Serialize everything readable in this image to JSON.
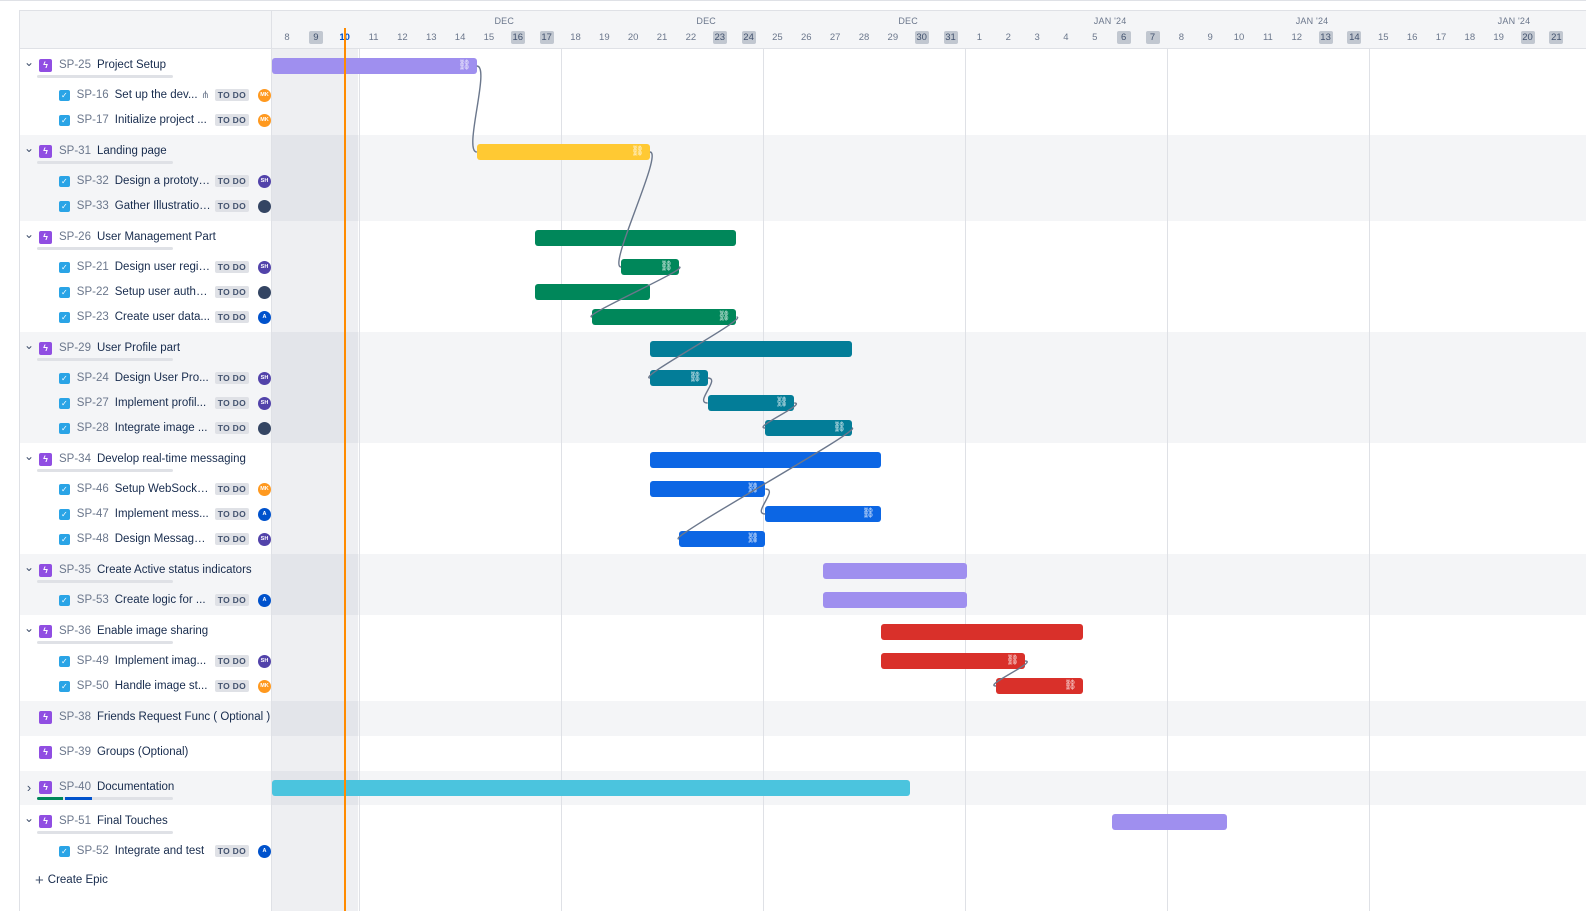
{
  "colors": {
    "violet": "#9f8fef",
    "yellow": "#ffc933",
    "green": "#00875a",
    "teal": "#037d98",
    "blue": "#0c66e4",
    "purple": "#9f8fef",
    "red": "#d9302a",
    "cyan": "#4bc4de",
    "today": "#ff8b00",
    "epic_icon": "#904ee2",
    "task_icon": "#2aa4e6"
  },
  "timeline": {
    "months": [
      "DEC",
      "DEC",
      "DEC",
      "JAN '24",
      "JAN '24",
      "JAN '24"
    ],
    "days": [
      "8",
      "9",
      "10",
      "11",
      "12",
      "13",
      "14",
      "15",
      "16",
      "17",
      "18",
      "19",
      "20",
      "21",
      "22",
      "23",
      "24",
      "25",
      "26",
      "27",
      "28",
      "29",
      "30",
      "31",
      "1",
      "2",
      "3",
      "4",
      "5",
      "6",
      "7",
      "8",
      "9",
      "10",
      "11",
      "12",
      "13",
      "14",
      "15",
      "16",
      "17",
      "18",
      "19",
      "20",
      "21"
    ],
    "weekend_days_index": [
      1,
      8,
      9,
      15,
      16,
      22,
      23,
      29,
      30,
      36,
      37,
      43,
      44
    ],
    "today_index": 2
  },
  "epics": [
    {
      "key": "SP-25",
      "summary": "Project Setup",
      "expanded": true,
      "color": "violet",
      "start": 0,
      "end": 7.1,
      "linked": true,
      "children": [
        {
          "key": "SP-16",
          "summary": "Set up the dev...",
          "hier": true,
          "status": "TO DO",
          "avatar": "MK",
          "avatar_color": "#ff991f"
        },
        {
          "key": "SP-17",
          "summary": "Initialize project ...",
          "status": "TO DO",
          "avatar": "MK",
          "avatar_color": "#ff991f"
        }
      ]
    },
    {
      "key": "SP-31",
      "summary": "Landing page",
      "expanded": true,
      "color": "yellow",
      "start": 7.1,
      "end": 13.1,
      "linked": true,
      "children": [
        {
          "key": "SP-32",
          "summary": "Design a prototype",
          "status": "TO DO",
          "avatar": "SH",
          "avatar_color": "#5243aa"
        },
        {
          "key": "SP-33",
          "summary": "Gather Illustrations",
          "status": "TO DO",
          "avatar": "",
          "avatar_color": "#344563"
        }
      ]
    },
    {
      "key": "SP-26",
      "summary": "User Management Part",
      "expanded": true,
      "color": "green",
      "start": 9.1,
      "end": 16.1,
      "linked": false,
      "children": [
        {
          "key": "SP-21",
          "summary": "Design user regis...",
          "status": "TO DO",
          "avatar": "SH",
          "avatar_color": "#5243aa",
          "start": 12.1,
          "end": 14.1,
          "linked": true
        },
        {
          "key": "SP-22",
          "summary": "Setup user authe...",
          "status": "TO DO",
          "avatar": "",
          "avatar_color": "#344563",
          "start": 9.1,
          "end": 13.1,
          "linked": false
        },
        {
          "key": "SP-23",
          "summary": "Create user data...",
          "status": "TO DO",
          "avatar": "A",
          "avatar_color": "#0052cc",
          "start": 11.1,
          "end": 16.1,
          "linked": true
        }
      ]
    },
    {
      "key": "SP-29",
      "summary": "User Profile part",
      "expanded": true,
      "color": "teal",
      "start": 13.1,
      "end": 20.1,
      "linked": false,
      "children": [
        {
          "key": "SP-24",
          "summary": "Design User Pro...",
          "status": "TO DO",
          "avatar": "SH",
          "avatar_color": "#5243aa",
          "start": 13.1,
          "end": 15.1,
          "linked": true
        },
        {
          "key": "SP-27",
          "summary": "Implement profil...",
          "status": "TO DO",
          "avatar": "SH",
          "avatar_color": "#5243aa",
          "start": 15.1,
          "end": 18.1,
          "linked": true
        },
        {
          "key": "SP-28",
          "summary": "Integrate image ...",
          "status": "TO DO",
          "avatar": "",
          "avatar_color": "#344563",
          "start": 17.1,
          "end": 20.1,
          "linked": true
        }
      ]
    },
    {
      "key": "SP-34",
      "summary": "Develop real-time messaging",
      "expanded": true,
      "color": "blue",
      "start": 13.1,
      "end": 21.1,
      "linked": false,
      "children": [
        {
          "key": "SP-46",
          "summary": "Setup WebSocke...",
          "status": "TO DO",
          "avatar": "MK",
          "avatar_color": "#ff991f",
          "start": 13.1,
          "end": 17.1,
          "linked": true
        },
        {
          "key": "SP-47",
          "summary": "Implement mess...",
          "status": "TO DO",
          "avatar": "A",
          "avatar_color": "#0052cc",
          "start": 17.1,
          "end": 21.1,
          "linked": true
        },
        {
          "key": "SP-48",
          "summary": "Design Message UI",
          "status": "TO DO",
          "avatar": "SH",
          "avatar_color": "#5243aa",
          "start": 14.1,
          "end": 17.1,
          "linked": true
        }
      ]
    },
    {
      "key": "SP-35",
      "summary": "Create Active status indicators",
      "expanded": true,
      "color": "purple",
      "start": 19.1,
      "end": 24.1,
      "linked": false,
      "children": [
        {
          "key": "SP-53",
          "summary": "Create logic for ...",
          "status": "TO DO",
          "avatar": "A",
          "avatar_color": "#0052cc",
          "start": 19.1,
          "end": 24.1,
          "linked": false
        }
      ]
    },
    {
      "key": "SP-36",
      "summary": "Enable image sharing",
      "expanded": true,
      "color": "red",
      "start": 21.1,
      "end": 28.1,
      "linked": false,
      "children": [
        {
          "key": "SP-49",
          "summary": "Implement imag...",
          "status": "TO DO",
          "avatar": "SH",
          "avatar_color": "#5243aa",
          "start": 21.1,
          "end": 26.1,
          "linked": true
        },
        {
          "key": "SP-50",
          "summary": "Handle image st...",
          "status": "TO DO",
          "avatar": "MK",
          "avatar_color": "#ff991f",
          "start": 25.1,
          "end": 28.1,
          "linked": true
        }
      ]
    },
    {
      "key": "SP-38",
      "summary": "Friends Request Func ( Optional )",
      "expanded": null,
      "children": []
    },
    {
      "key": "SP-39",
      "summary": "Groups (Optional)",
      "expanded": null,
      "children": []
    },
    {
      "key": "SP-40",
      "summary": "Documentation",
      "expanded": false,
      "color": "cyan",
      "start": 0,
      "end": 22.1,
      "linked": false,
      "progress": {
        "done": 0.19,
        "inprogress": 0.2
      },
      "children": []
    },
    {
      "key": "SP-51",
      "summary": "Final Touches",
      "expanded": true,
      "color": "purple",
      "start": 29.1,
      "end": 33.1,
      "linked": false,
      "children": [
        {
          "key": "SP-52",
          "summary": "Integrate and test",
          "status": "TO DO",
          "avatar": "A",
          "avatar_color": "#0052cc"
        }
      ]
    }
  ],
  "create_epic_label": "Create Epic"
}
